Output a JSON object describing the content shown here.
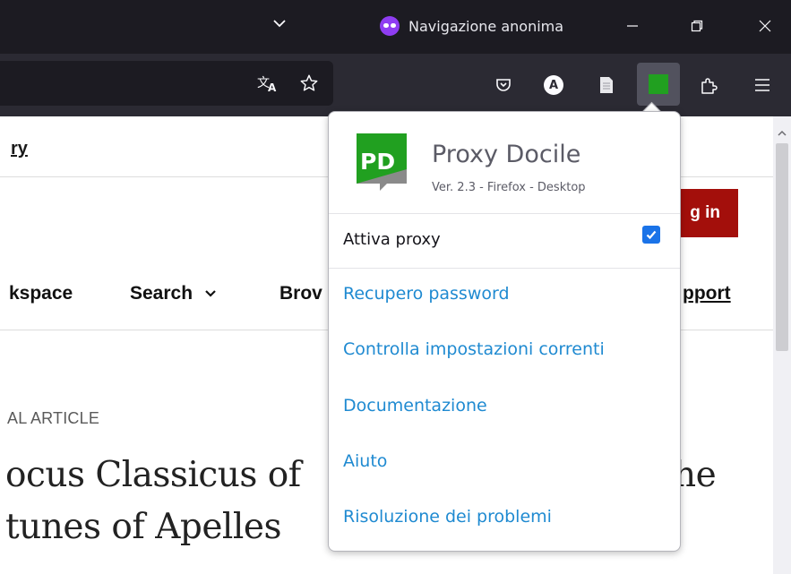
{
  "window": {
    "private_label": "Navigazione anonima"
  },
  "toolbar": {
    "icons": [
      "translate-icon",
      "star-icon",
      "pocket-icon",
      "adblock-icon",
      "reader-icon",
      "proxy-extension-icon",
      "extensions-icon",
      "menu-icon"
    ],
    "accent": "#21a020"
  },
  "page": {
    "top_link": "ry",
    "login_label": "g in",
    "nav": {
      "workspace": "kspace",
      "search": "Search",
      "browse": "Brov",
      "support": "pport"
    },
    "article_type": "AL ARTICLE",
    "headline_line1": "ocus Classicus of",
    "headline_line1_tail": "he",
    "headline_line2": "tunes of Apelles",
    "brand_color": "#a30f0b"
  },
  "popup": {
    "logo_text": "PD",
    "app_name": "Proxy Docile",
    "version": "Ver. 2.3 - Firefox - Desktop",
    "toggle_label": "Attiva proxy",
    "toggle_checked": true,
    "links": [
      "Recupero password",
      "Controlla impostazioni correnti",
      "Documentazione",
      "Aiuto",
      "Risoluzione dei problemi"
    ],
    "link_color": "#1f8ad1",
    "logo_color": "#21a020"
  }
}
